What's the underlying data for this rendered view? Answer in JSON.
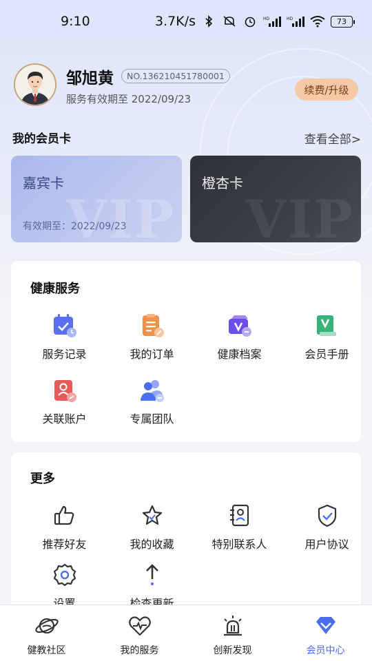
{
  "status_bar": {
    "time": "9:10",
    "network_speed": "3.7K/s",
    "battery": "73",
    "signal_badge_1": "HD",
    "signal_badge_2": "HD"
  },
  "profile": {
    "name": "邹旭黄",
    "member_no": "NO.136210451780001",
    "expiry": "服务有效期至 2022/09/23",
    "renew_label": "续费/升级"
  },
  "member_cards": {
    "title": "我的会员卡",
    "view_all": "查看全部>",
    "cards": [
      {
        "name": "嘉宾卡",
        "expiry": "有效期至：2022/09/23",
        "watermark": "VIP"
      },
      {
        "name": "橙杏卡",
        "watermark": "VIP"
      }
    ]
  },
  "health_services": {
    "title": "健康服务",
    "items": [
      {
        "label": "服务记录",
        "icon": "calendar-check-icon"
      },
      {
        "label": "我的订单",
        "icon": "order-list-icon"
      },
      {
        "label": "健康档案",
        "icon": "health-archive-icon"
      },
      {
        "label": "会员手册",
        "icon": "member-handbook-icon"
      },
      {
        "label": "关联账户",
        "icon": "linked-account-icon"
      },
      {
        "label": "专属团队",
        "icon": "team-icon"
      }
    ]
  },
  "more": {
    "title": "更多",
    "items": [
      {
        "label": "推荐好友",
        "icon": "thumbs-up-icon"
      },
      {
        "label": "我的收藏",
        "icon": "star-icon"
      },
      {
        "label": "特别联系人",
        "icon": "contact-book-icon"
      },
      {
        "label": "用户协议",
        "icon": "shield-check-icon"
      },
      {
        "label": "设置",
        "icon": "gear-icon"
      },
      {
        "label": "检查更新",
        "icon": "arrow-up-icon"
      }
    ]
  },
  "bottom_nav": {
    "items": [
      {
        "label": "健教社区",
        "icon": "planet-icon"
      },
      {
        "label": "我的服务",
        "icon": "heart-pulse-icon"
      },
      {
        "label": "创新发现",
        "icon": "alarm-light-icon"
      },
      {
        "label": "会员中心",
        "icon": "diamond-icon",
        "active": true
      }
    ]
  },
  "colors": {
    "accent": "#4b6ef0",
    "renew_bg": "#f5c9a6",
    "renew_text": "#7b3d17"
  }
}
